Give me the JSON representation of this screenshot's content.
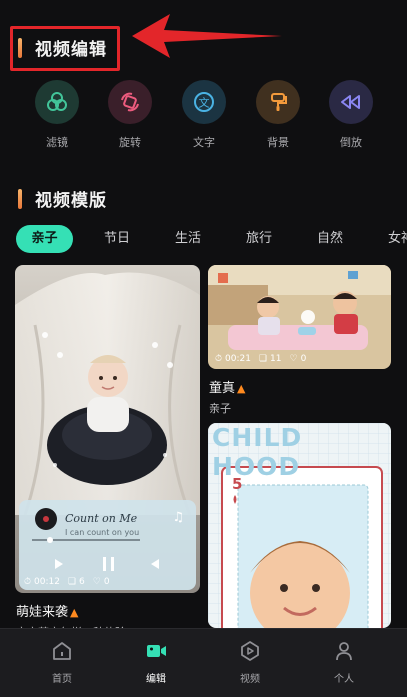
{
  "video_edit": {
    "title": "视频编辑"
  },
  "tools": [
    {
      "icon": "filter-icon",
      "label": "滤镜",
      "color": "#42c59a",
      "bg": "#1e3a33"
    },
    {
      "icon": "rotate-icon",
      "label": "旋转",
      "color": "#ec5b7e",
      "bg": "#3a1f2a"
    },
    {
      "icon": "text-icon",
      "label": "文字",
      "color": "#4ab3e4",
      "bg": "#1b3442"
    },
    {
      "icon": "background-icon",
      "label": "背景",
      "color": "#f39a3c",
      "bg": "#40301f"
    },
    {
      "icon": "rewind-icon",
      "label": "倒放",
      "color": "#8a86f2",
      "bg": "#2a2944"
    }
  ],
  "templates": {
    "title": "视频模版"
  },
  "tabs": [
    "亲子",
    "节日",
    "生活",
    "旅行",
    "自然",
    "女神"
  ],
  "active_tab": "亲子",
  "cards": [
    {
      "title": "萌娃来袭",
      "subtitle": "宝宝萌宝怎样一种体验",
      "duration": "00:12",
      "clips": "6",
      "likes": "0",
      "song_title": "Count on Me",
      "song_lyric": "I can count on you"
    },
    {
      "title": "童真",
      "subtitle": "亲子",
      "duration": "00:21",
      "clips": "11",
      "likes": "0"
    },
    {
      "banner_text": "CHILD HOOD",
      "card_rank": "5"
    }
  ],
  "nav": [
    {
      "icon": "home-icon",
      "label": "首页"
    },
    {
      "icon": "edit-icon",
      "label": "编辑"
    },
    {
      "icon": "video-icon",
      "label": "视频"
    },
    {
      "icon": "profile-icon",
      "label": "个人"
    }
  ],
  "nav_active": "编辑",
  "colors": {
    "accent_green": "#35e0b5",
    "annotation_red": "#e3262a",
    "flame": "#ff8a1f"
  }
}
